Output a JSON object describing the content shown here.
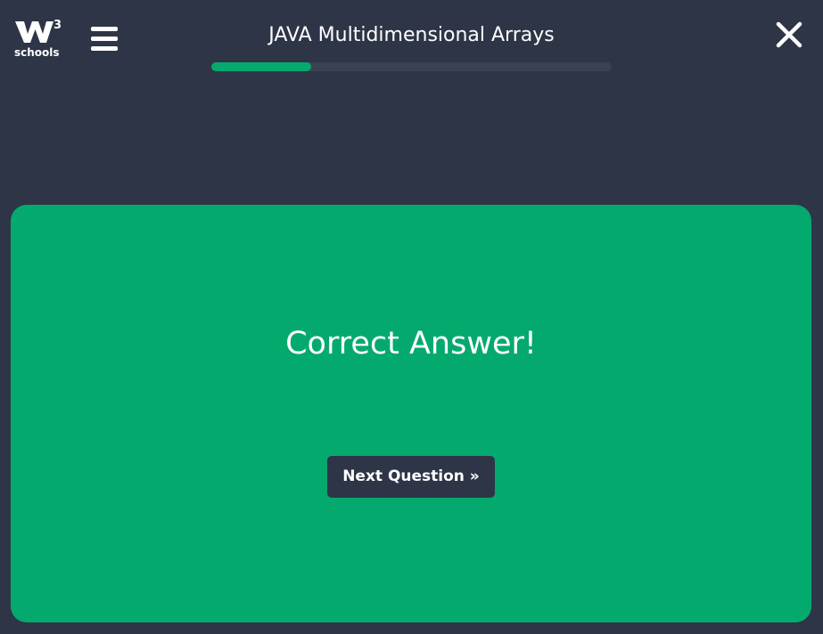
{
  "header": {
    "logo": {
      "superscript": "3",
      "text": "schools",
      "icon": "w3schools-logo-icon"
    },
    "menu_icon": "hamburger-menu-icon",
    "title": "JAVA Multidimensional Arrays",
    "progress": 0.25,
    "close_icon": "close-icon"
  },
  "result": {
    "message": "Correct Answer!",
    "next_label": "Next Question »"
  },
  "colors": {
    "background": "#2e3547",
    "accent": "#04aa6d",
    "progress_track": "#3a4254",
    "text": "#ffffff"
  }
}
